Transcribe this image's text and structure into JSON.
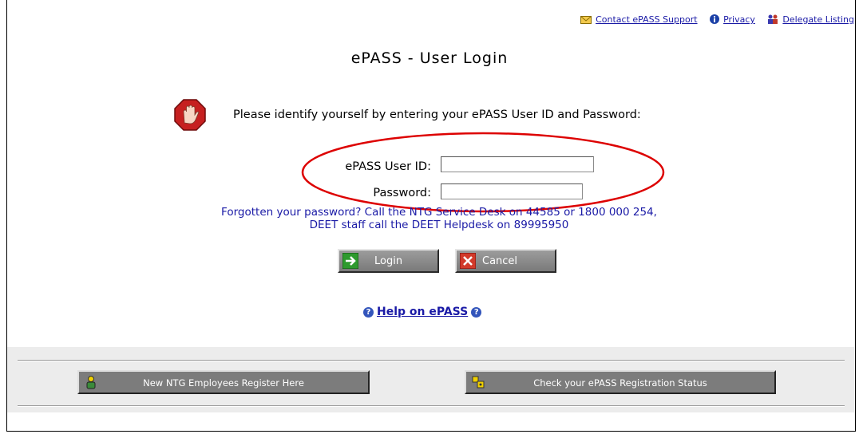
{
  "links": {
    "contact": "Contact ePASS Support",
    "privacy": "Privacy",
    "delegate": "Delegate Listing"
  },
  "page_title": "ePASS - User Login",
  "prompt": "Please identify yourself by entering your ePASS User ID and Password:",
  "form": {
    "userid_label": "ePASS User ID:",
    "userid_value": "",
    "password_label": "Password:",
    "password_value": ""
  },
  "forgot": {
    "line1": "Forgotten your password? Call the NTG Service Desk on 44585 or 1800 000 254,",
    "line2": "DEET staff call the DEET Helpdesk on 89995950"
  },
  "buttons": {
    "login": "Login",
    "cancel": "Cancel"
  },
  "help_link": "Help on ePASS",
  "footer": {
    "register": "New NTG Employees Register Here",
    "check_status": "Check your ePASS Registration Status"
  },
  "colors": {
    "link": "#1a1aa6",
    "annotation_ellipse": "#dd0000"
  }
}
